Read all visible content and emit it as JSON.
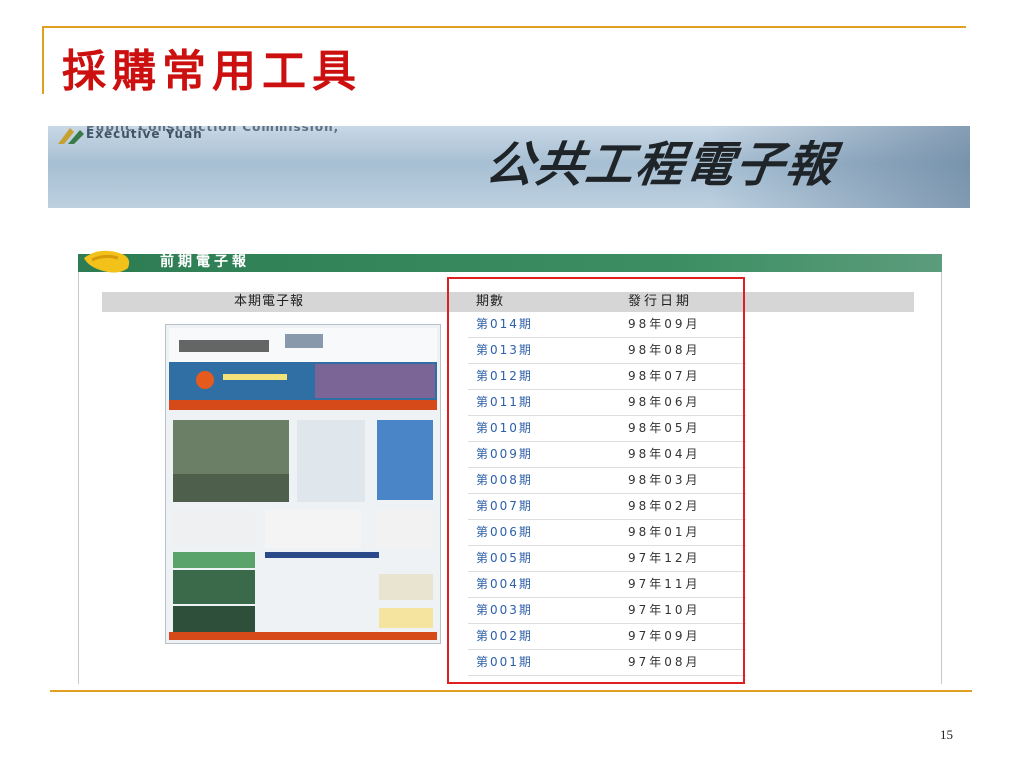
{
  "slide": {
    "title": "採購常用工具",
    "page_number": "15"
  },
  "website": {
    "agency_name_clipped": "Public Construction Commission,",
    "agency_name": "Executive Yuan",
    "newsletter_logo": "公共工程電子報",
    "section_title": "前期電子報",
    "current_issue_label": "本期電子報",
    "columns": {
      "issue": "期數",
      "date": "發行日期"
    },
    "issues": [
      {
        "issue": "第014期",
        "date": "98年09月"
      },
      {
        "issue": "第013期",
        "date": "98年08月"
      },
      {
        "issue": "第012期",
        "date": "98年07月"
      },
      {
        "issue": "第011期",
        "date": "98年06月"
      },
      {
        "issue": "第010期",
        "date": "98年05月"
      },
      {
        "issue": "第009期",
        "date": "98年04月"
      },
      {
        "issue": "第008期",
        "date": "98年03月"
      },
      {
        "issue": "第007期",
        "date": "98年02月"
      },
      {
        "issue": "第006期",
        "date": "98年01月"
      },
      {
        "issue": "第005期",
        "date": "97年12月"
      },
      {
        "issue": "第004期",
        "date": "97年11月"
      },
      {
        "issue": "第003期",
        "date": "97年10月"
      },
      {
        "issue": "第002期",
        "date": "97年09月"
      },
      {
        "issue": "第001期",
        "date": "97年08月"
      }
    ]
  },
  "colors": {
    "title_red": "#cc1010",
    "rule_gold": "#e0a020",
    "section_green": "#2d7c53",
    "link_blue": "#2c5fa8",
    "highlight_red": "#e02020"
  },
  "icons": {
    "agency_logo": "agency-logo-icon",
    "section": "scroll-icon"
  }
}
